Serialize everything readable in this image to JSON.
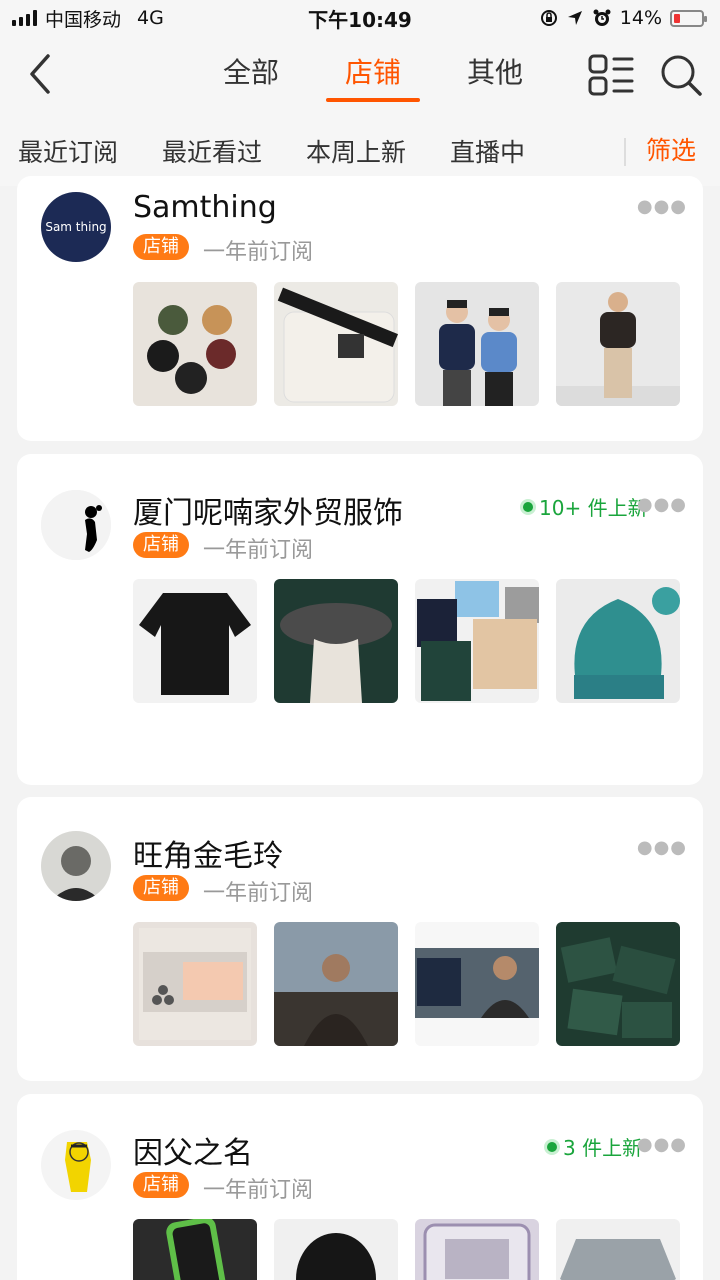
{
  "status_bar": {
    "carrier": "中国移动",
    "network": "4G",
    "time": "下午10:49",
    "battery": "14%"
  },
  "nav": {
    "tabs": [
      "全部",
      "店铺",
      "其他"
    ],
    "active_tab": "店铺"
  },
  "filters": {
    "items": [
      "最近订阅",
      "最近看过",
      "本周上新",
      "直播中"
    ],
    "filter_label": "筛选"
  },
  "shops": [
    {
      "name": "Samthing",
      "avatar_text": "Sam thing",
      "tag": "店铺",
      "subscribed": "一年前订阅",
      "new_count": ""
    },
    {
      "name": "厦门呢喃家外贸服饰",
      "tag": "店铺",
      "subscribed": "一年前订阅",
      "new_count": "10+ 件上新"
    },
    {
      "name": "旺角金毛玲",
      "tag": "店铺",
      "subscribed": "一年前订阅",
      "new_count": ""
    },
    {
      "name": "因父之名",
      "tag": "店铺",
      "subscribed": "一年前订阅",
      "new_count": "3 件上新"
    }
  ],
  "colors": {
    "accent": "#ff5500",
    "tag_bg": "#ff7a14",
    "new_green": "#1aa53c"
  }
}
